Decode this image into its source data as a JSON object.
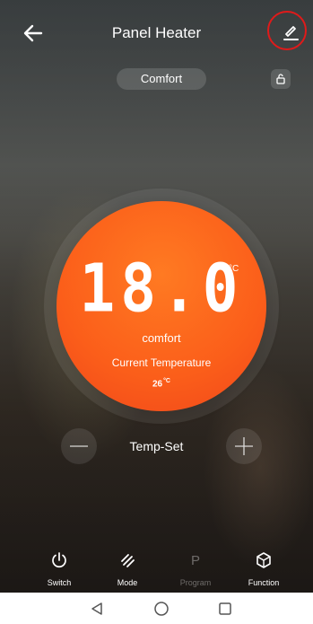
{
  "header": {
    "title": "Panel Heater",
    "back_icon": "arrow-left-icon",
    "edit_icon": "pencil-icon",
    "highlight_color": "#e01a1a"
  },
  "mode": {
    "label": "Comfort",
    "lock_icon": "lock-open-icon"
  },
  "dial": {
    "set_temperature": "18.0",
    "unit": "°C",
    "mode_text": "comfort",
    "current_label": "Current Temperature",
    "current_value": "26",
    "current_unit": "°C",
    "color": "#fb5e1a"
  },
  "temp_set": {
    "label": "Temp-Set",
    "minus_icon": "minus-icon",
    "plus_icon": "plus-icon"
  },
  "functions": [
    {
      "label": "Switch",
      "icon": "power-icon",
      "enabled": true
    },
    {
      "label": "Mode",
      "icon": "mode-icon",
      "enabled": true
    },
    {
      "label": "Program",
      "icon": "program-icon",
      "glyph": "P",
      "enabled": false
    },
    {
      "label": "Function",
      "icon": "cube-icon",
      "enabled": true
    }
  ],
  "system_nav": {
    "back_icon": "triangle-back-icon",
    "home_icon": "circle-home-icon",
    "recents_icon": "square-recents-icon"
  }
}
